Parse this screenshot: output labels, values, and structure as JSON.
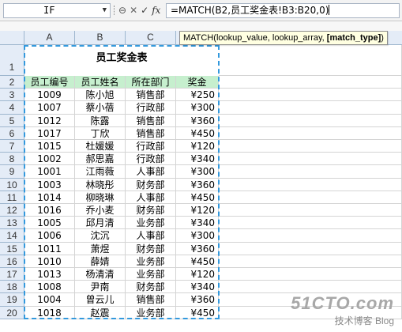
{
  "name_box": {
    "value": "IF"
  },
  "formula_bar": {
    "cancel_glyph": "✕",
    "enter_glyph": "✓",
    "fx_label": "fx",
    "formula": "=MATCH(B2,员工奖金表!B3:B20,0)"
  },
  "tooltip": {
    "prefix": "MATCH(lookup_value, lookup_array, ",
    "active_arg": "[match_type]",
    "suffix": ")"
  },
  "columns": [
    "A",
    "B",
    "C",
    "D"
  ],
  "title": "员工奖金表",
  "headers": [
    "员工编号",
    "员工姓名",
    "所在部门",
    "奖金"
  ],
  "rows": [
    [
      "1009",
      "陈小旭",
      "销售部",
      "¥250"
    ],
    [
      "1007",
      "蔡小蓓",
      "行政部",
      "¥300"
    ],
    [
      "1012",
      "陈露",
      "销售部",
      "¥360"
    ],
    [
      "1017",
      "丁欣",
      "销售部",
      "¥450"
    ],
    [
      "1015",
      "杜媛媛",
      "行政部",
      "¥120"
    ],
    [
      "1002",
      "郝思嘉",
      "行政部",
      "¥340"
    ],
    [
      "1001",
      "江雨薇",
      "人事部",
      "¥300"
    ],
    [
      "1003",
      "林晓彤",
      "财务部",
      "¥360"
    ],
    [
      "1014",
      "柳晓琳",
      "人事部",
      "¥450"
    ],
    [
      "1016",
      "乔小麦",
      "财务部",
      "¥120"
    ],
    [
      "1005",
      "邱月清",
      "业务部",
      "¥340"
    ],
    [
      "1006",
      "沈沉",
      "人事部",
      "¥300"
    ],
    [
      "1011",
      "萧煜",
      "财务部",
      "¥360"
    ],
    [
      "1010",
      "薛婧",
      "业务部",
      "¥450"
    ],
    [
      "1013",
      "杨清清",
      "业务部",
      "¥120"
    ],
    [
      "1008",
      "尹南",
      "财务部",
      "¥340"
    ],
    [
      "1004",
      "曾云儿",
      "销售部",
      "¥360"
    ],
    [
      "1018",
      "赵震",
      "业务部",
      "¥450"
    ]
  ],
  "watermark": {
    "site": "51CTO.com",
    "subtitle": "技术博客  Blog"
  },
  "colors": {
    "header_fill": "#c6efce",
    "selection_border": "#3399dd",
    "header_bg": "#e4ecf7"
  }
}
